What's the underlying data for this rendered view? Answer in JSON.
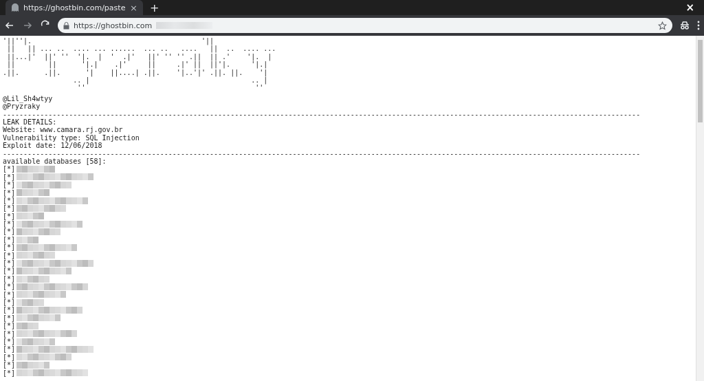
{
  "browser": {
    "tab": {
      "title": "https://ghostbin.com/paste",
      "close": "×",
      "selected": true
    },
    "new_tab": "+",
    "window_close": "×",
    "url": {
      "value": "https://ghostbin.com"
    }
  },
  "paste": {
    "banner": [
      "'||''|.                                         '||",
      " ||   || ... ..  .... ... ......  ... ..   ....   ||  ..  .... ...",
      " ||...|'  ||' ''  '|.  |  '  .|'   ||' '' '' .||  || .'    '|.  |",
      " ||        ||      '|.|    .|'     ||     .|' ||  ||'|.     '|.|",
      ".||.      .||.      '|    ||....| .||.    '|..'|' .||. ||.    '|",
      "                 .. |                                       .. |",
      "                  ''                                         ''"
    ],
    "credits": [
      "@Lil_Sh4wtyy",
      "@Pryzraky"
    ],
    "rule": "----------------------------------------------------------------------------------------------------------------------------------------------------------",
    "details": [
      "LEAK DETAILS:",
      "Website: www.camara.rj.gov.br",
      "Vulnerability type: SQL Injection",
      "Exploit date: 12/06/2018"
    ],
    "rule_2": "----------------------------------------------------------------------------------------------------------------------------------------------------------",
    "databases_heading": "available databases [58]:",
    "databases": [
      {
        "marker": "[*]"
      },
      {
        "marker": "[*]"
      },
      {
        "marker": "[*]"
      },
      {
        "marker": "[*]"
      },
      {
        "marker": "[*]"
      },
      {
        "marker": "[*]"
      },
      {
        "marker": "[*]"
      },
      {
        "marker": "[*]"
      },
      {
        "marker": "[*]"
      },
      {
        "marker": "[*]"
      },
      {
        "marker": "[*]"
      },
      {
        "marker": "[*]"
      },
      {
        "marker": "[*]"
      },
      {
        "marker": "[*]"
      },
      {
        "marker": "[*]"
      },
      {
        "marker": "[*]"
      },
      {
        "marker": "[*]"
      },
      {
        "marker": "[*]"
      },
      {
        "marker": "[*]"
      },
      {
        "marker": "[*]"
      },
      {
        "marker": "[*]"
      },
      {
        "marker": "[*]"
      },
      {
        "marker": "[*]"
      },
      {
        "marker": "[*]"
      },
      {
        "marker": "[*]"
      },
      {
        "marker": "[*]"
      },
      {
        "marker": "[*]"
      }
    ]
  }
}
